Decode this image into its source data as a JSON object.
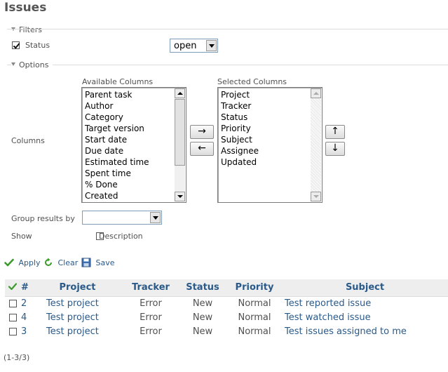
{
  "page_title": "Issues",
  "filters": {
    "legend": "Filters",
    "status_label": "Status",
    "status_checked": true,
    "status_value": "open"
  },
  "options": {
    "legend": "Options",
    "columns_label": "Columns",
    "available_label": "Available Columns",
    "selected_label": "Selected Columns",
    "available": [
      "Parent task",
      "Author",
      "Category",
      "Target version",
      "Start date",
      "Due date",
      "Estimated time",
      "Spent time",
      "% Done",
      "Created"
    ],
    "selected": [
      "Project",
      "Tracker",
      "Status",
      "Priority",
      "Subject",
      "Assignee",
      "Updated"
    ],
    "move_right": "→",
    "move_left": "←",
    "move_up": "↑",
    "move_down": "↓",
    "group_by_label": "Group results by",
    "group_by_value": "",
    "show_label": "Show",
    "description_label": "Description"
  },
  "actions": {
    "apply": "Apply",
    "clear": "Clear",
    "save": "Save"
  },
  "table": {
    "headers": [
      "#",
      "Project",
      "Tracker",
      "Status",
      "Priority",
      "Subject"
    ],
    "rows": [
      {
        "id": "2",
        "project": "Test project",
        "tracker": "Error",
        "status": "New",
        "priority": "Normal",
        "subject": "Test reported issue"
      },
      {
        "id": "4",
        "project": "Test project",
        "tracker": "Error",
        "status": "New",
        "priority": "Normal",
        "subject": "Test watched issue"
      },
      {
        "id": "3",
        "project": "Test project",
        "tracker": "Error",
        "status": "New",
        "priority": "Normal",
        "subject": "Test issues assigned to me"
      }
    ]
  },
  "pagination": "(1-3/3)",
  "colors": {
    "link": "#2a5a8a",
    "header_bg": "#eeeeee",
    "apply_green": "#3a9a2a"
  }
}
